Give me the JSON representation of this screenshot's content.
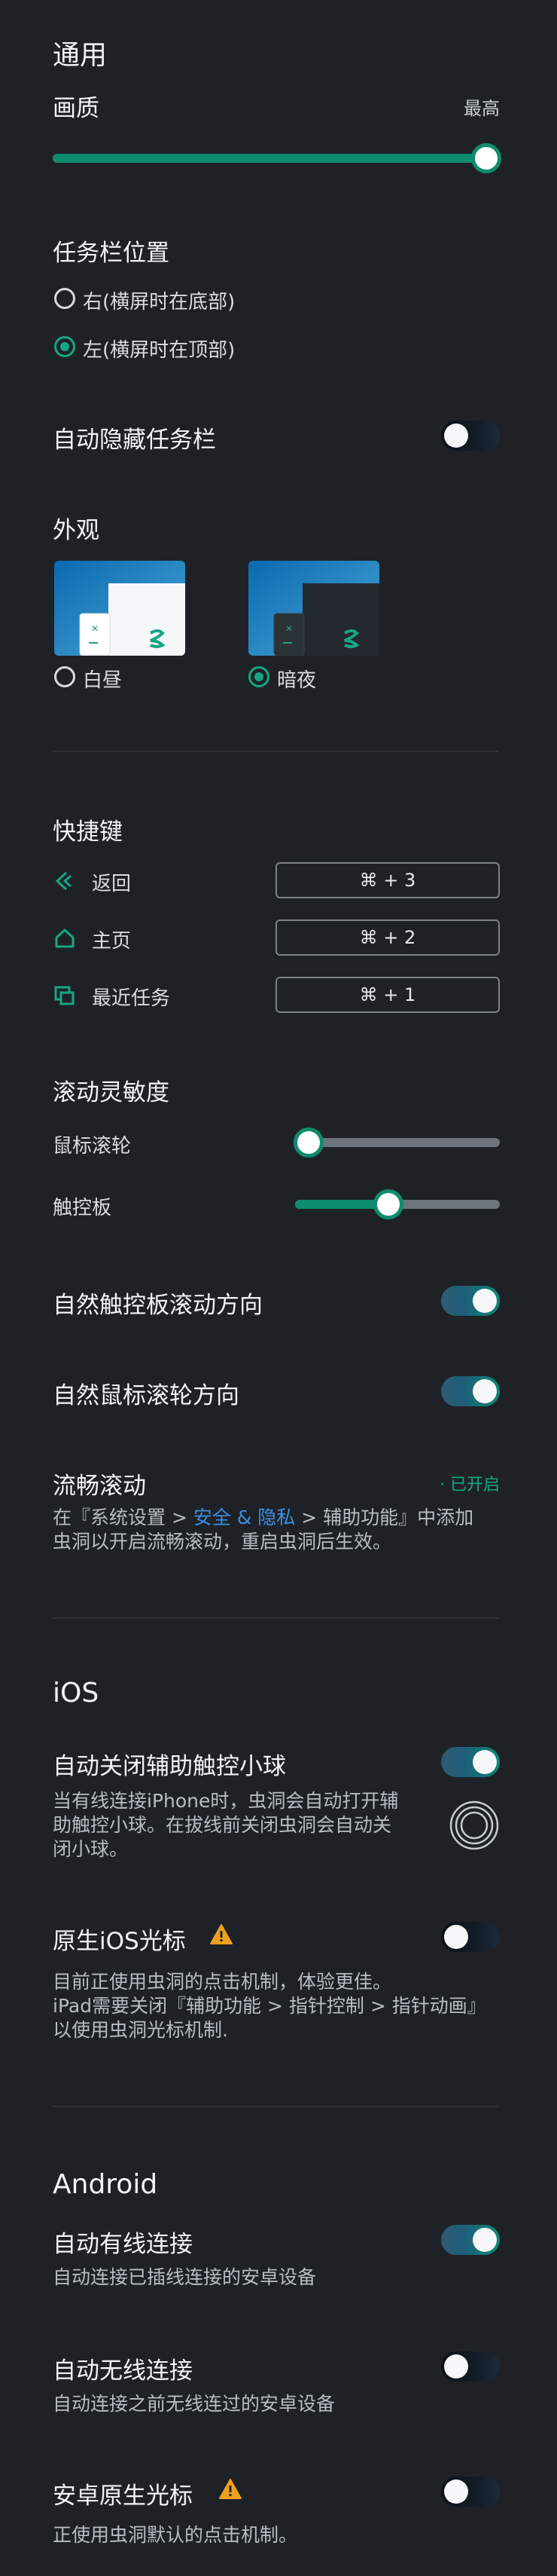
{
  "general": {
    "title": "通用",
    "quality_label": "画质",
    "quality_value_label": "最高",
    "quality_level": 1.0
  },
  "taskbar": {
    "title": "任务栏位置",
    "options": [
      {
        "label": "右(横屏时在底部)",
        "selected": false
      },
      {
        "label": "左(横屏时在顶部)",
        "selected": true
      }
    ],
    "autohide_label": "自动隐藏任务栏",
    "autohide": false
  },
  "appearance": {
    "title": "外观",
    "options": [
      {
        "label": "白昼",
        "selected": false
      },
      {
        "label": "暗夜",
        "selected": true
      }
    ]
  },
  "shortcuts": {
    "title": "快捷键",
    "items": [
      {
        "label": "返回",
        "icon": "back-icon",
        "key": "⌘ + 3"
      },
      {
        "label": "主页",
        "icon": "home-icon",
        "key": "⌘ + 2"
      },
      {
        "label": "最近任务",
        "icon": "recent-tasks-icon",
        "key": "⌘ + 1"
      }
    ]
  },
  "scroll": {
    "title": "滚动灵敏度",
    "mouse_label": "鼠标滚轮",
    "mouse_level": 0.0,
    "trackpad_label": "触控板",
    "trackpad_level": 0.45,
    "natural_trackpad_label": "自然触控板滚动方向",
    "natural_trackpad": true,
    "natural_mouse_label": "自然鼠标滚轮方向",
    "natural_mouse": true,
    "smooth_title": "流畅滚动",
    "smooth_status": "· 已开启",
    "smooth_desc_1": "在『系统设置 > ",
    "smooth_desc_link": "安全 & 隐私",
    "smooth_desc_2": " > 辅助功能』中添加",
    "smooth_desc_line2": "虫洞以开启流畅滚动，重启虫洞后生效。"
  },
  "ios": {
    "title": "iOS",
    "assistive_label": "自动关闭辅助触控小球",
    "assistive": true,
    "assistive_desc_1": "当有线连接iPhone时，虫洞会自动打开辅",
    "assistive_desc_2": "助触控小球。在拔线前关闭虫洞会自动关",
    "assistive_desc_3": "闭小球。",
    "cursor_label": "原生iOS光标",
    "cursor": false,
    "cursor_desc_1": "目前正使用虫洞的点击机制，体验更佳。",
    "cursor_desc_2": "iPad需要关闭『辅助功能 > 指针控制 > 指针动画』",
    "cursor_desc_3": "以使用虫洞光标机制."
  },
  "android": {
    "title": "Android",
    "wired_label": "自动有线连接",
    "wired": true,
    "wired_desc": "自动连接已插线连接的安卓设备",
    "wireless_label": "自动无线连接",
    "wireless": false,
    "wireless_desc": "自动连接之前无线连过的安卓设备",
    "cursor_label": "安卓原生光标",
    "cursor": false,
    "cursor_desc": "正使用虫洞默认的点击机制。"
  },
  "colors": {
    "background": "#1e2227",
    "accent": "#0e8c6e",
    "link": "#3d8fe0",
    "warning": "#f0a020"
  }
}
